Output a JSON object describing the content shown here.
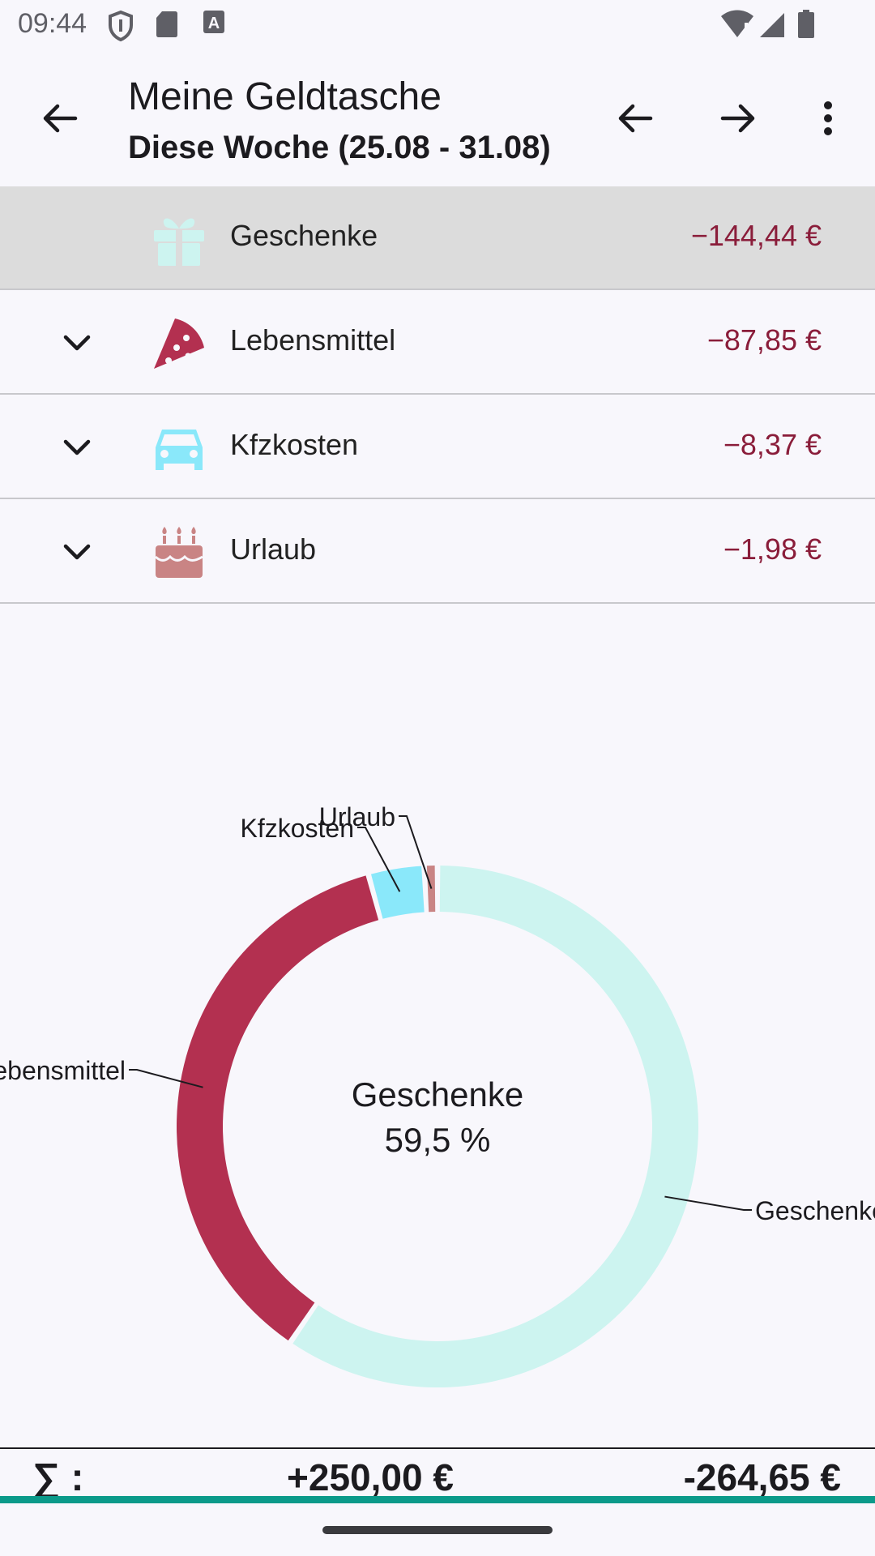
{
  "status_bar": {
    "time": "09:44",
    "icons": [
      "shield-icon",
      "sd-card-icon",
      "font-a-icon",
      "wifi-alert-icon",
      "signal-icon",
      "battery-icon"
    ]
  },
  "app_bar": {
    "title": "Meine Geldtasche",
    "subtitle": "Diese Woche (25.08 - 31.08)",
    "icons": [
      "back-arrow-icon",
      "previous-period-icon",
      "next-period-icon",
      "more-vert-icon"
    ]
  },
  "categories": [
    {
      "label": "Geschenke",
      "amount": "−144,44 €",
      "icon": "gift-icon",
      "color": "#cdf4f0",
      "selected": true,
      "expandable": false
    },
    {
      "label": "Lebensmittel",
      "amount": "−87,85 €",
      "icon": "pizza-icon",
      "color": "#b33050",
      "selected": false,
      "expandable": true
    },
    {
      "label": "Kfzkosten",
      "amount": "−8,37 €",
      "icon": "car-icon",
      "color": "#8ae8fa",
      "selected": false,
      "expandable": true
    },
    {
      "label": "Urlaub",
      "amount": "−1,98 €",
      "icon": "cake-icon",
      "color": "#c98484",
      "selected": false,
      "expandable": true
    }
  ],
  "chart_data": {
    "type": "pie",
    "style": "donut",
    "center_label": "Geschenke",
    "center_value": "59,5 %",
    "slices": [
      {
        "label": "Geschenke",
        "value": 144.44,
        "color": "#cdf4f0"
      },
      {
        "label": "Lebensmittel",
        "value": 87.85,
        "color": "#b33050"
      },
      {
        "label": "Kfzkosten",
        "value": 8.37,
        "color": "#8ae8fa"
      },
      {
        "label": "Urlaub",
        "value": 1.98,
        "color": "#c98484"
      }
    ]
  },
  "footer": {
    "sum_label": "∑ :",
    "income": "+250,00 €",
    "expense": "-264,65 €"
  },
  "colors": {
    "accent": "#0b9a8a",
    "negative_amount": "#8a1d3a",
    "selected_row": "#dcdcdc"
  }
}
